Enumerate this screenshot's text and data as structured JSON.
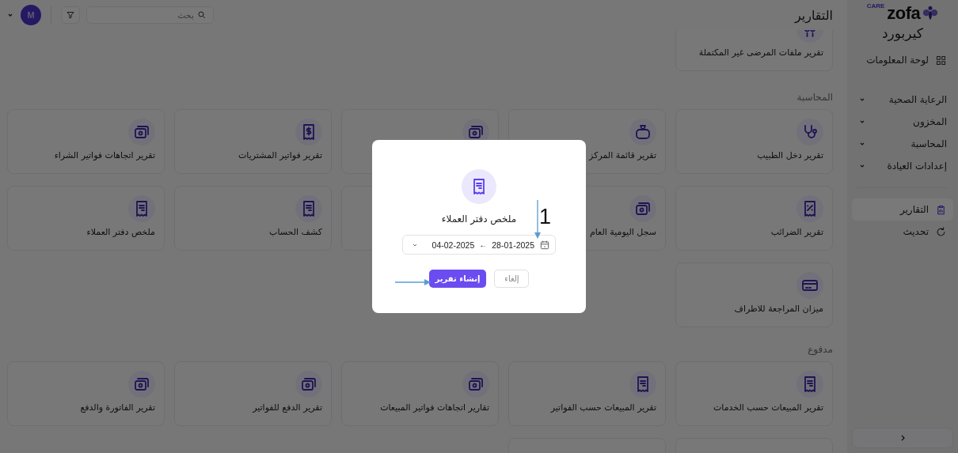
{
  "sidebar": {
    "logo": {
      "word": "zofa",
      "tag": "CARE"
    },
    "clinic": "كيربورد",
    "items": [
      {
        "label": "لوحة المعلومات",
        "kind": "dashboard",
        "selected": false
      },
      {
        "label": "الرعاية الصحية",
        "kind": "group",
        "expanded": false
      },
      {
        "label": "المخزون",
        "kind": "group",
        "expanded": false
      },
      {
        "label": "المحاسبة",
        "kind": "group",
        "expanded": false
      },
      {
        "label": "إعدادات العيادة",
        "kind": "group",
        "expanded": false
      },
      {
        "kind": "divider"
      },
      {
        "label": "التقارير",
        "kind": "reports",
        "selected": true
      },
      {
        "label": "تحديث",
        "kind": "refresh",
        "selected": false
      }
    ]
  },
  "topbar": {
    "title": "التقارير",
    "search": {
      "placeholder": "بحث"
    },
    "avatar": "M"
  },
  "sections": [
    {
      "cards": [
        {
          "label": "تقرير ملفات المرضى غير المكتملة",
          "kind": "users"
        }
      ]
    },
    {
      "title": "المحاسبة",
      "cards": [
        {
          "label": "تقرير دخل الطبيب",
          "kind": "stethoscope"
        },
        {
          "label": "تقرير قائمة المركز",
          "kind": "bag"
        },
        {
          "kind": "money"
        },
        {
          "label": "تقرير فواتير المشتريات",
          "kind": "receipt-dollar"
        },
        {
          "label": "تقرير اتجاهات فواتير الشراء",
          "kind": "money"
        },
        {
          "label": "تقرير الضرائب",
          "kind": "receipt-percent"
        },
        {
          "label": "سجل اليومية العام",
          "kind": "money"
        },
        {
          "kind": "plain"
        },
        {
          "label": "كشف الحساب",
          "kind": "receipt"
        },
        {
          "label": "ملخص دفتر العملاء",
          "kind": "receipt"
        },
        {
          "label": "ميزان المراجعة للاطراف",
          "kind": "card"
        }
      ]
    },
    {
      "title": "مدفوع",
      "cards": [
        {
          "label": "تقرير المبيعات حسب الخدمات",
          "kind": "receipt"
        },
        {
          "label": "تقرير المبيعات حسب الفواتير",
          "kind": "receipt"
        },
        {
          "label": "تقارير اتجاهات فواتير المبيعات",
          "kind": "money"
        },
        {
          "label": "تقرير الدفع للفواتير",
          "kind": "money"
        },
        {
          "label": "تقرير الفاتورة والدفع",
          "kind": "money"
        },
        {
          "kind": "plain"
        },
        {
          "kind": "plain"
        }
      ]
    }
  ],
  "modal": {
    "kind": "receipt",
    "title": "ملخص دفتر العملاء",
    "date_range": {
      "start": "28-01-2025",
      "separator": "←",
      "end": "04-02-2025"
    },
    "buttons": [
      {
        "label": "إلغاء",
        "kind": "secondary"
      },
      {
        "label": "إنشاء تقرير",
        "kind": "primary"
      }
    ],
    "annotations": [
      {
        "kind": "down",
        "label": "1"
      },
      {
        "kind": "right"
      }
    ]
  }
}
